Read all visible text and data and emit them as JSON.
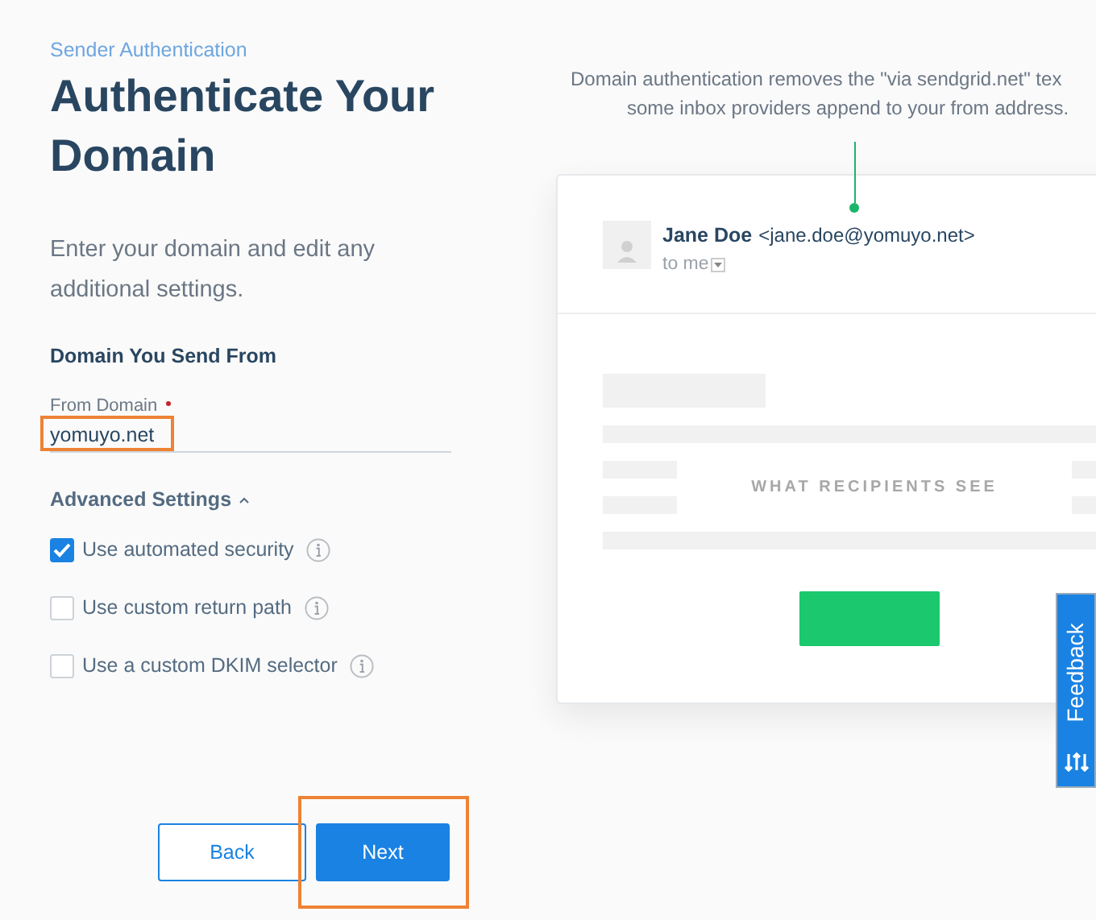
{
  "breadcrumb": "Sender Authentication",
  "title": "Authenticate Your Domain",
  "description": "Enter your domain and edit any additional settings.",
  "section_heading": "Domain You Send From",
  "from_domain": {
    "label": "From Domain",
    "required": true,
    "value": "yomuyo.net",
    "highlighted": true
  },
  "advanced_settings": {
    "label": "Advanced Settings",
    "expanded": true
  },
  "options": [
    {
      "label": "Use automated security",
      "checked": true
    },
    {
      "label": "Use custom return path",
      "checked": false
    },
    {
      "label": "Use a custom DKIM selector",
      "checked": false
    }
  ],
  "buttons": [
    {
      "label": "Back",
      "kind": "secondary",
      "highlighted": false
    },
    {
      "label": "Next",
      "kind": "primary",
      "highlighted": true
    }
  ],
  "preview": {
    "intro_lines": [
      "Domain authentication removes the \"via sendgrid.net\" tex",
      "some inbox providers append to your from address."
    ],
    "sender_name": "Jane Doe",
    "sender_address": "<jane.doe@yomuyo.net>",
    "recipient": "to me",
    "caption": "WHAT RECIPIENTS SEE"
  },
  "feedback_tab": "Feedback"
}
